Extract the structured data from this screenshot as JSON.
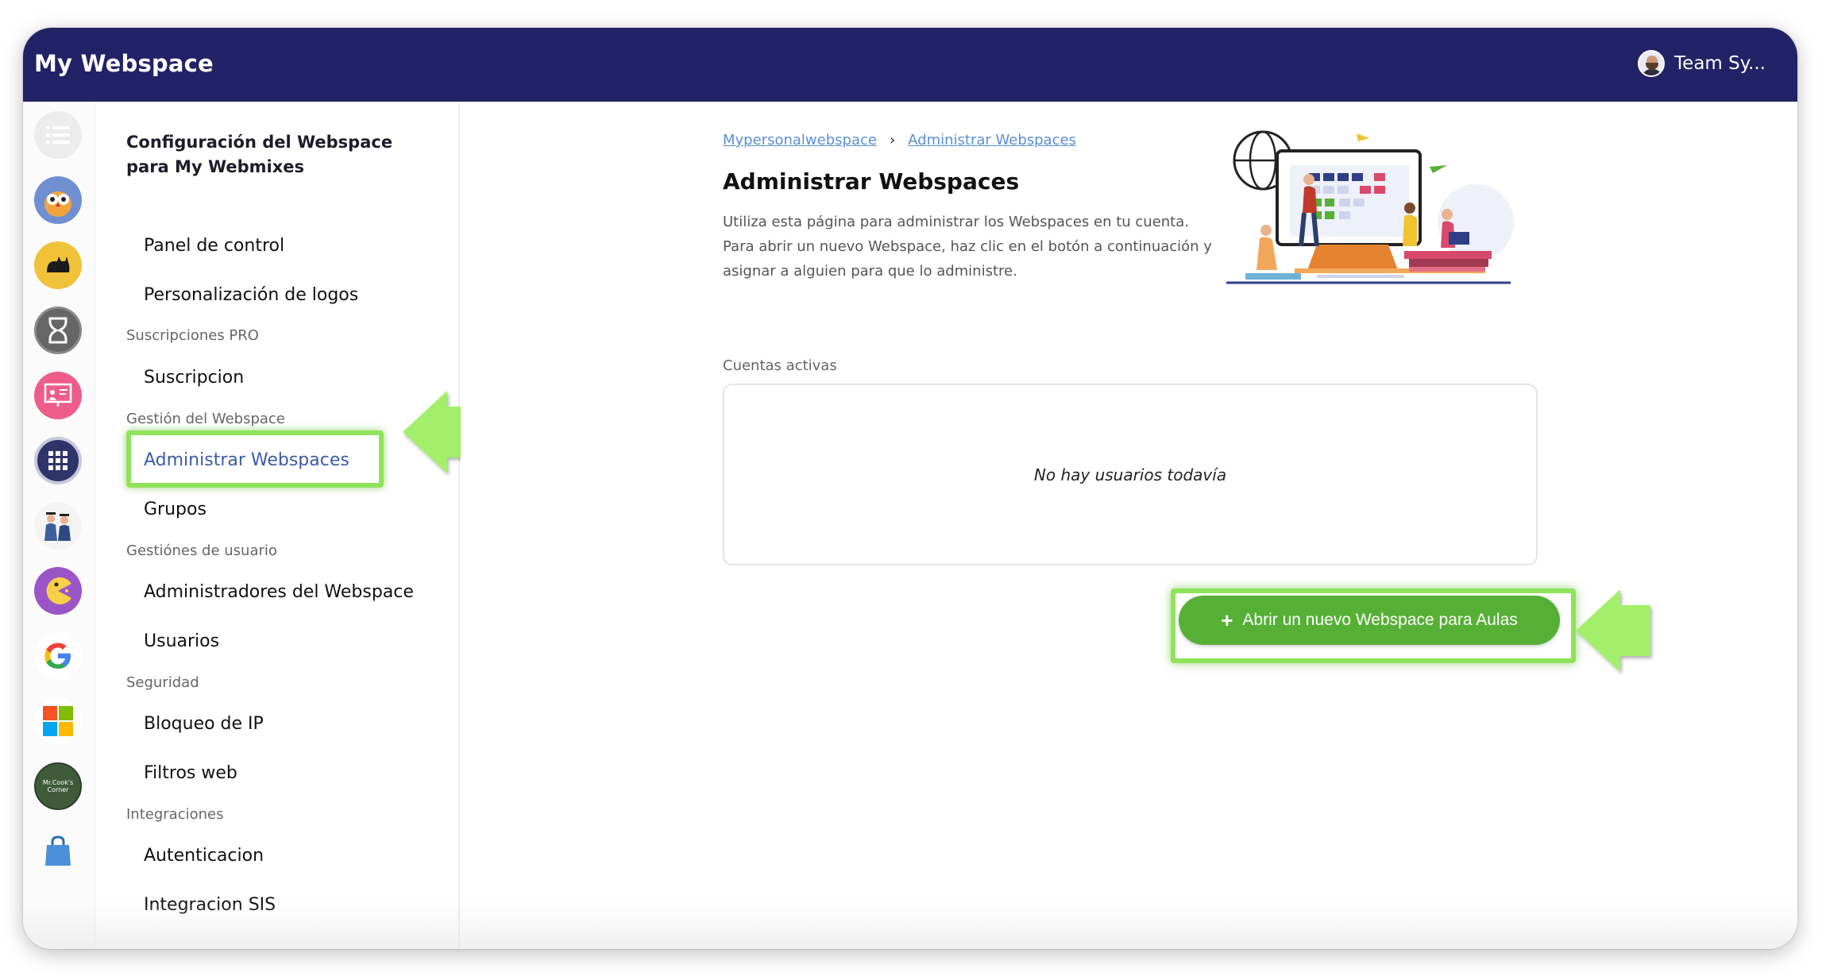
{
  "header": {
    "app_title": "My Webspace",
    "user_name": "Team Sy..."
  },
  "icon_rail": [
    {
      "name": "list-icon",
      "color": "#e6e6e6"
    },
    {
      "name": "owl-icon",
      "color": "#6f8fd1"
    },
    {
      "name": "cat-icon",
      "color": "#f0c23a"
    },
    {
      "name": "hourglass-icon",
      "color": "#666666"
    },
    {
      "name": "teacher-board-icon",
      "color": "#ee5d8a"
    },
    {
      "name": "grid-apps-icon",
      "color": "#2f356b"
    },
    {
      "name": "graduates-icon",
      "color": "#3f5d9a"
    },
    {
      "name": "pacman-icon",
      "color": "#9b55c7"
    },
    {
      "name": "google-icon",
      "color": "#ffffff"
    },
    {
      "name": "microsoft-icon",
      "color": "#ffffff"
    },
    {
      "name": "mr-cooks-corner-icon",
      "label": "Mr.Cook's Corner",
      "color": "#3f5b3a"
    },
    {
      "name": "shopping-bag-icon",
      "color": "#4a90d9"
    }
  ],
  "sidebar": {
    "heading": "Configuración del Webspace para My Webmixes",
    "items": {
      "panel": "Panel de control",
      "logos": "Personalización de logos",
      "section_pro": "Suscripciones PRO",
      "suscripcion": "Suscripcion",
      "section_gestion": "Gestión del Webspace",
      "administrar": "Administrar Webspaces",
      "grupos": "Grupos",
      "section_usuario": "Gestiónes de usuario",
      "admins": "Administradores del Webspace",
      "usuarios": "Usuarios",
      "section_seguridad": "Seguridad",
      "bloqueo": "Bloqueo de IP",
      "filtros": "Filtros web",
      "section_integraciones": "Integraciones",
      "autenticacion": "Autenticacion",
      "sis": "Integracion SIS"
    }
  },
  "main": {
    "breadcrumb": [
      "Mypersonalwebspace",
      "Administrar Webspaces"
    ],
    "breadcrumb_separator": "›",
    "title": "Administrar Webspaces",
    "description": "Utiliza esta página para administrar los Webspaces en tu cuenta. Para abrir un nuevo Webspace, haz clic en el botón a continuación y asignar a alguien para que lo administre.",
    "list_label": "Cuentas activas",
    "empty_text": "No hay usuarios todavía",
    "cta_label": "Abrir un nuevo Webspace para Aulas",
    "cta_plus": "+"
  },
  "colors": {
    "topbar": "#222266",
    "highlight": "#8fe35a",
    "cta": "#56b036",
    "link": "#5b8ed6",
    "active_item": "#3a5ba8"
  }
}
